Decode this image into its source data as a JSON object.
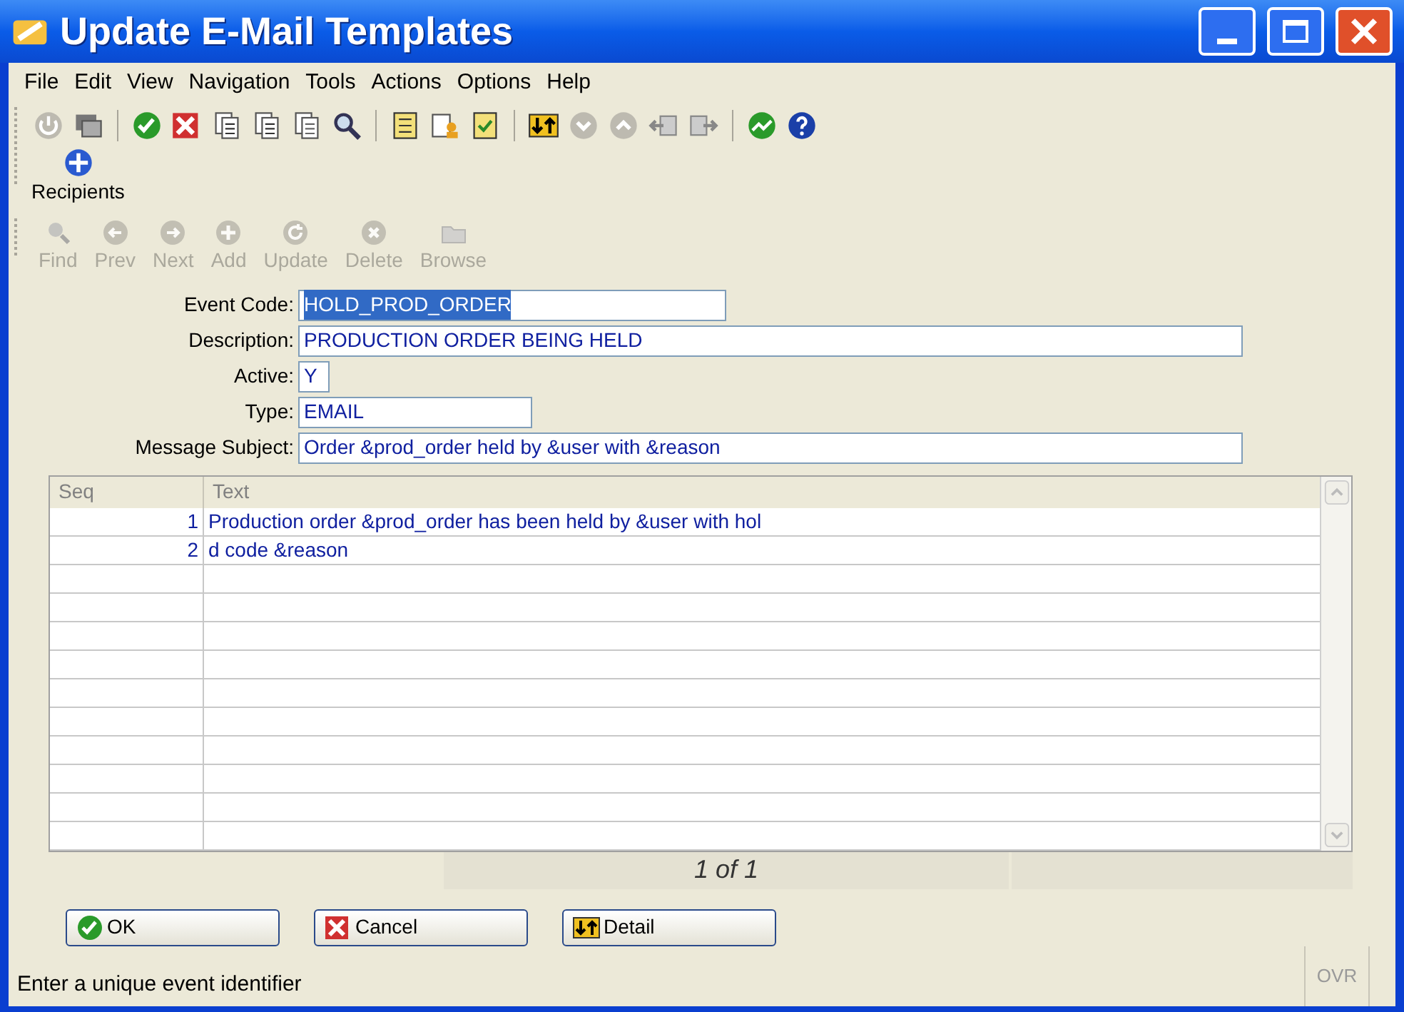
{
  "window": {
    "title": "Update E-Mail Templates"
  },
  "menu": [
    "File",
    "Edit",
    "View",
    "Navigation",
    "Tools",
    "Actions",
    "Options",
    "Help"
  ],
  "recipients_button": {
    "label": "Recipients"
  },
  "nav_toolbar": [
    {
      "label": "Find",
      "disabled": true
    },
    {
      "label": "Prev",
      "disabled": true
    },
    {
      "label": "Next",
      "disabled": true
    },
    {
      "label": "Add",
      "disabled": true
    },
    {
      "label": "Update",
      "disabled": true
    },
    {
      "label": "Delete",
      "disabled": true
    },
    {
      "label": "Browse",
      "disabled": true
    }
  ],
  "fields": [
    {
      "label": "Event Code:",
      "value": "HOLD_PROD_ORDER",
      "selected": true,
      "kind": "code"
    },
    {
      "label": "Description:",
      "value": "PRODUCTION ORDER BEING HELD",
      "selected": false,
      "kind": "long"
    },
    {
      "label": "Active:",
      "value": "Y",
      "selected": false,
      "kind": "flag"
    },
    {
      "label": "Type:",
      "value": "EMAIL",
      "selected": false,
      "kind": "short"
    },
    {
      "label": "Message Subject:",
      "value": "Order &prod_order held by &user with &reason",
      "selected": false,
      "kind": "long"
    }
  ],
  "table": {
    "columns": [
      "Seq",
      "Text"
    ],
    "rows": [
      {
        "seq": "1",
        "text": "Production order &prod_order has been held by &user with hol"
      },
      {
        "seq": "2",
        "text": "d code &reason"
      }
    ]
  },
  "pager": "1 of 1",
  "buttons": [
    {
      "label": "OK",
      "kind": "ok"
    },
    {
      "label": "Cancel",
      "kind": "cancel"
    },
    {
      "label": "Detail",
      "kind": "detail"
    }
  ],
  "status_bar": {
    "message": "Enter a unique event identifier",
    "mode": "OVR"
  }
}
